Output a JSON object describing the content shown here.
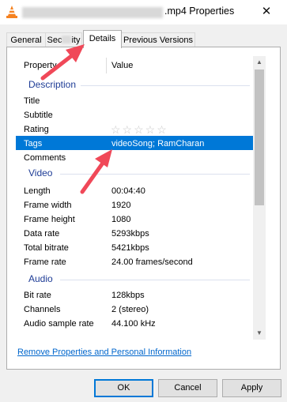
{
  "window": {
    "title": ".mp4 Properties",
    "close_glyph": "✕"
  },
  "tabs": [
    {
      "label": "General"
    },
    {
      "label_start": "Sec",
      "label_end": "ity"
    },
    {
      "label": "Details"
    },
    {
      "label": "Previous Versions"
    }
  ],
  "list": {
    "col_property": "Property",
    "col_value": "Value",
    "groups": {
      "description": "Description",
      "video": "Video",
      "audio": "Audio"
    },
    "description_rows": [
      {
        "property": "Title",
        "value": ""
      },
      {
        "property": "Subtitle",
        "value": ""
      },
      {
        "property": "Rating",
        "value": ""
      },
      {
        "property": "Tags",
        "value": "videoSong; RamCharan"
      },
      {
        "property": "Comments",
        "value": ""
      }
    ],
    "rating": {
      "stars": "☆☆☆☆☆",
      "value": 0,
      "max": 5
    },
    "video_rows": [
      {
        "property": "Length",
        "value": "00:04:40"
      },
      {
        "property": "Frame width",
        "value": "1920"
      },
      {
        "property": "Frame height",
        "value": "1080"
      },
      {
        "property": "Data rate",
        "value": "5293kbps"
      },
      {
        "property": "Total bitrate",
        "value": "5421kbps"
      },
      {
        "property": "Frame rate",
        "value": "24.00 frames/second"
      }
    ],
    "audio_rows": [
      {
        "property": "Bit rate",
        "value": "128kbps"
      },
      {
        "property": "Channels",
        "value": "2 (stereo)"
      },
      {
        "property": "Audio sample rate",
        "value": "44.100 kHz"
      }
    ],
    "selected_row": "Tags"
  },
  "scrollbar": {
    "up_glyph": "▲",
    "down_glyph": "▼"
  },
  "link": "Remove Properties and Personal Information",
  "buttons": {
    "ok": "OK",
    "cancel": "Cancel",
    "apply": "Apply"
  },
  "colors": {
    "selection": "#0078d7",
    "group_header": "#1e3c96",
    "link": "#0066cc",
    "arrow": "#f04858",
    "icon_orange": "#f58220"
  }
}
